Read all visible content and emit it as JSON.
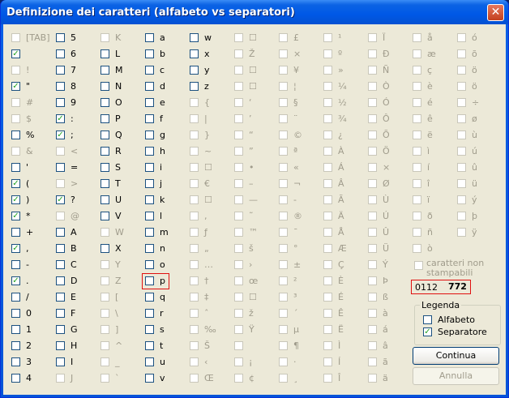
{
  "window": {
    "title": "Definizione dei caratteri (alfabeto vs separatori)",
    "close_glyph": "✕"
  },
  "grid_columns": [
    [
      {
        "l": "[TAB]",
        "c": false,
        "d": true
      },
      {
        "l": "",
        "c": true,
        "d": false
      },
      {
        "l": "!",
        "c": false,
        "d": true
      },
      {
        "l": "\"",
        "c": true,
        "d": false
      },
      {
        "l": "#",
        "c": false,
        "d": true
      },
      {
        "l": "$",
        "c": false,
        "d": true
      },
      {
        "l": "%",
        "c": false,
        "d": false
      },
      {
        "l": "&",
        "c": false,
        "d": true
      },
      {
        "l": "'",
        "c": false,
        "d": false
      },
      {
        "l": "(",
        "c": true,
        "d": false
      },
      {
        "l": ")",
        "c": true,
        "d": false
      },
      {
        "l": "*",
        "c": true,
        "d": false
      },
      {
        "l": "+",
        "c": false,
        "d": false
      },
      {
        "l": ",",
        "c": true,
        "d": false
      },
      {
        "l": "-",
        "c": false,
        "d": false
      },
      {
        "l": ".",
        "c": true,
        "d": false
      },
      {
        "l": "/",
        "c": false,
        "d": false
      },
      {
        "l": "0",
        "c": false,
        "d": false
      },
      {
        "l": "1",
        "c": false,
        "d": false
      },
      {
        "l": "2",
        "c": false,
        "d": false
      },
      {
        "l": "3",
        "c": false,
        "d": false
      },
      {
        "l": "4",
        "c": false,
        "d": false
      }
    ],
    [
      {
        "l": "5",
        "c": false,
        "d": false
      },
      {
        "l": "6",
        "c": false,
        "d": false
      },
      {
        "l": "7",
        "c": false,
        "d": false
      },
      {
        "l": "8",
        "c": false,
        "d": false
      },
      {
        "l": "9",
        "c": false,
        "d": false
      },
      {
        "l": ":",
        "c": true,
        "d": false
      },
      {
        "l": ";",
        "c": true,
        "d": false
      },
      {
        "l": "<",
        "c": false,
        "d": true
      },
      {
        "l": "=",
        "c": false,
        "d": false
      },
      {
        "l": ">",
        "c": false,
        "d": true
      },
      {
        "l": "?",
        "c": true,
        "d": false
      },
      {
        "l": "@",
        "c": false,
        "d": true
      },
      {
        "l": "A",
        "c": false,
        "d": false
      },
      {
        "l": "B",
        "c": false,
        "d": false
      },
      {
        "l": "C",
        "c": false,
        "d": false
      },
      {
        "l": "D",
        "c": false,
        "d": false
      },
      {
        "l": "E",
        "c": false,
        "d": false
      },
      {
        "l": "F",
        "c": false,
        "d": false
      },
      {
        "l": "G",
        "c": false,
        "d": false
      },
      {
        "l": "H",
        "c": false,
        "d": false
      },
      {
        "l": "I",
        "c": false,
        "d": false
      },
      {
        "l": "J",
        "c": false,
        "d": true
      }
    ],
    [
      {
        "l": "K",
        "c": false,
        "d": true
      },
      {
        "l": "L",
        "c": false,
        "d": false
      },
      {
        "l": "M",
        "c": false,
        "d": false
      },
      {
        "l": "N",
        "c": false,
        "d": false
      },
      {
        "l": "O",
        "c": false,
        "d": false
      },
      {
        "l": "P",
        "c": false,
        "d": false
      },
      {
        "l": "Q",
        "c": false,
        "d": false
      },
      {
        "l": "R",
        "c": false,
        "d": false
      },
      {
        "l": "S",
        "c": false,
        "d": false
      },
      {
        "l": "T",
        "c": false,
        "d": false
      },
      {
        "l": "U",
        "c": false,
        "d": false
      },
      {
        "l": "V",
        "c": false,
        "d": false
      },
      {
        "l": "W",
        "c": false,
        "d": true
      },
      {
        "l": "X",
        "c": false,
        "d": false
      },
      {
        "l": "Y",
        "c": false,
        "d": true
      },
      {
        "l": "Z",
        "c": false,
        "d": true
      },
      {
        "l": "[",
        "c": false,
        "d": true
      },
      {
        "l": "\\",
        "c": false,
        "d": true
      },
      {
        "l": "]",
        "c": false,
        "d": true
      },
      {
        "l": "^",
        "c": false,
        "d": true
      },
      {
        "l": "_",
        "c": false,
        "d": true
      },
      {
        "l": "`",
        "c": false,
        "d": true
      }
    ],
    [
      {
        "l": "a",
        "c": false,
        "d": false
      },
      {
        "l": "b",
        "c": false,
        "d": false
      },
      {
        "l": "c",
        "c": false,
        "d": false
      },
      {
        "l": "d",
        "c": false,
        "d": false
      },
      {
        "l": "e",
        "c": false,
        "d": false
      },
      {
        "l": "f",
        "c": false,
        "d": false
      },
      {
        "l": "g",
        "c": false,
        "d": false
      },
      {
        "l": "h",
        "c": false,
        "d": false
      },
      {
        "l": "i",
        "c": false,
        "d": false
      },
      {
        "l": "j",
        "c": false,
        "d": false
      },
      {
        "l": "k",
        "c": false,
        "d": false
      },
      {
        "l": "l",
        "c": false,
        "d": false
      },
      {
        "l": "m",
        "c": false,
        "d": false
      },
      {
        "l": "n",
        "c": false,
        "d": false
      },
      {
        "l": "o",
        "c": false,
        "d": false
      },
      {
        "l": "p",
        "c": false,
        "d": false,
        "hl": true
      },
      {
        "l": "q",
        "c": false,
        "d": false
      },
      {
        "l": "r",
        "c": false,
        "d": false
      },
      {
        "l": "s",
        "c": false,
        "d": false
      },
      {
        "l": "t",
        "c": false,
        "d": false
      },
      {
        "l": "u",
        "c": false,
        "d": false
      },
      {
        "l": "v",
        "c": false,
        "d": false
      }
    ],
    [
      {
        "l": "w",
        "c": false,
        "d": false
      },
      {
        "l": "x",
        "c": false,
        "d": false
      },
      {
        "l": "y",
        "c": false,
        "d": false
      },
      {
        "l": "z",
        "c": false,
        "d": false
      },
      {
        "l": "{",
        "c": false,
        "d": true
      },
      {
        "l": "|",
        "c": false,
        "d": true
      },
      {
        "l": "}",
        "c": false,
        "d": true
      },
      {
        "l": "~",
        "c": false,
        "d": true
      },
      {
        "l": "☐",
        "c": false,
        "d": true
      },
      {
        "l": "€",
        "c": false,
        "d": true
      },
      {
        "l": "☐",
        "c": false,
        "d": true
      },
      {
        "l": ",",
        "c": false,
        "d": true
      },
      {
        "l": "ƒ",
        "c": false,
        "d": true
      },
      {
        "l": "„",
        "c": false,
        "d": true
      },
      {
        "l": "…",
        "c": false,
        "d": true
      },
      {
        "l": "†",
        "c": false,
        "d": true
      },
      {
        "l": "‡",
        "c": false,
        "d": true
      },
      {
        "l": "ˆ",
        "c": false,
        "d": true
      },
      {
        "l": "‰",
        "c": false,
        "d": true
      },
      {
        "l": "Š",
        "c": false,
        "d": true
      },
      {
        "l": "‹",
        "c": false,
        "d": true
      },
      {
        "l": "Œ",
        "c": false,
        "d": true
      }
    ],
    [
      {
        "l": "☐",
        "c": false,
        "d": true
      },
      {
        "l": "Ž",
        "c": false,
        "d": true
      },
      {
        "l": "☐",
        "c": false,
        "d": true
      },
      {
        "l": "☐",
        "c": false,
        "d": true
      },
      {
        "l": "‘",
        "c": false,
        "d": true
      },
      {
        "l": "’",
        "c": false,
        "d": true
      },
      {
        "l": "“",
        "c": false,
        "d": true
      },
      {
        "l": "”",
        "c": false,
        "d": true
      },
      {
        "l": "•",
        "c": false,
        "d": true
      },
      {
        "l": "–",
        "c": false,
        "d": true
      },
      {
        "l": "—",
        "c": false,
        "d": true
      },
      {
        "l": "˜",
        "c": false,
        "d": true
      },
      {
        "l": "™",
        "c": false,
        "d": true
      },
      {
        "l": "š",
        "c": false,
        "d": true
      },
      {
        "l": "›",
        "c": false,
        "d": true
      },
      {
        "l": "œ",
        "c": false,
        "d": true
      },
      {
        "l": "☐",
        "c": false,
        "d": true
      },
      {
        "l": "ž",
        "c": false,
        "d": true
      },
      {
        "l": "Ÿ",
        "c": false,
        "d": true
      },
      {
        "l": "",
        "c": false,
        "d": true
      },
      {
        "l": "¡",
        "c": false,
        "d": true
      },
      {
        "l": "¢",
        "c": false,
        "d": true
      }
    ],
    [
      {
        "l": "£",
        "c": false,
        "d": true
      },
      {
        "l": "×",
        "c": false,
        "d": true
      },
      {
        "l": "¥",
        "c": false,
        "d": true
      },
      {
        "l": "¦",
        "c": false,
        "d": true
      },
      {
        "l": "§",
        "c": false,
        "d": true
      },
      {
        "l": "¨",
        "c": false,
        "d": true
      },
      {
        "l": "©",
        "c": false,
        "d": true
      },
      {
        "l": "ª",
        "c": false,
        "d": true
      },
      {
        "l": "«",
        "c": false,
        "d": true
      },
      {
        "l": "¬",
        "c": false,
        "d": true
      },
      {
        "l": "-",
        "c": false,
        "d": true
      },
      {
        "l": "®",
        "c": false,
        "d": true
      },
      {
        "l": "¯",
        "c": false,
        "d": true
      },
      {
        "l": "°",
        "c": false,
        "d": true
      },
      {
        "l": "±",
        "c": false,
        "d": true
      },
      {
        "l": "²",
        "c": false,
        "d": true
      },
      {
        "l": "³",
        "c": false,
        "d": true
      },
      {
        "l": "´",
        "c": false,
        "d": true
      },
      {
        "l": "µ",
        "c": false,
        "d": true
      },
      {
        "l": "¶",
        "c": false,
        "d": true
      },
      {
        "l": "·",
        "c": false,
        "d": true
      },
      {
        "l": "¸",
        "c": false,
        "d": true
      }
    ],
    [
      {
        "l": "¹",
        "c": false,
        "d": true
      },
      {
        "l": "º",
        "c": false,
        "d": true
      },
      {
        "l": "»",
        "c": false,
        "d": true
      },
      {
        "l": "¼",
        "c": false,
        "d": true
      },
      {
        "l": "½",
        "c": false,
        "d": true
      },
      {
        "l": "¾",
        "c": false,
        "d": true
      },
      {
        "l": "¿",
        "c": false,
        "d": true
      },
      {
        "l": "À",
        "c": false,
        "d": true
      },
      {
        "l": "Á",
        "c": false,
        "d": true
      },
      {
        "l": "Â",
        "c": false,
        "d": true
      },
      {
        "l": "Ã",
        "c": false,
        "d": true
      },
      {
        "l": "Ä",
        "c": false,
        "d": true
      },
      {
        "l": "Å",
        "c": false,
        "d": true
      },
      {
        "l": "Æ",
        "c": false,
        "d": true
      },
      {
        "l": "Ç",
        "c": false,
        "d": true
      },
      {
        "l": "È",
        "c": false,
        "d": true
      },
      {
        "l": "É",
        "c": false,
        "d": true
      },
      {
        "l": "Ê",
        "c": false,
        "d": true
      },
      {
        "l": "Ë",
        "c": false,
        "d": true
      },
      {
        "l": "Ì",
        "c": false,
        "d": true
      },
      {
        "l": "Í",
        "c": false,
        "d": true
      },
      {
        "l": "Î",
        "c": false,
        "d": true
      }
    ],
    [
      {
        "l": "Ï",
        "c": false,
        "d": true
      },
      {
        "l": "Ð",
        "c": false,
        "d": true
      },
      {
        "l": "Ñ",
        "c": false,
        "d": true
      },
      {
        "l": "Ò",
        "c": false,
        "d": true
      },
      {
        "l": "Ó",
        "c": false,
        "d": true
      },
      {
        "l": "Ô",
        "c": false,
        "d": true
      },
      {
        "l": "Õ",
        "c": false,
        "d": true
      },
      {
        "l": "Ö",
        "c": false,
        "d": true
      },
      {
        "l": "×",
        "c": false,
        "d": true
      },
      {
        "l": "Ø",
        "c": false,
        "d": true
      },
      {
        "l": "Ù",
        "c": false,
        "d": true
      },
      {
        "l": "Ú",
        "c": false,
        "d": true
      },
      {
        "l": "Û",
        "c": false,
        "d": true
      },
      {
        "l": "Ü",
        "c": false,
        "d": true
      },
      {
        "l": "Ý",
        "c": false,
        "d": true
      },
      {
        "l": "Þ",
        "c": false,
        "d": true
      },
      {
        "l": "ß",
        "c": false,
        "d": true
      },
      {
        "l": "à",
        "c": false,
        "d": true
      },
      {
        "l": "á",
        "c": false,
        "d": true
      },
      {
        "l": "â",
        "c": false,
        "d": true
      },
      {
        "l": "ã",
        "c": false,
        "d": true
      },
      {
        "l": "ä",
        "c": false,
        "d": true
      }
    ],
    [
      {
        "l": "å",
        "c": false,
        "d": true
      },
      {
        "l": "æ",
        "c": false,
        "d": true
      },
      {
        "l": "ç",
        "c": false,
        "d": true
      },
      {
        "l": "è",
        "c": false,
        "d": true
      },
      {
        "l": "é",
        "c": false,
        "d": true
      },
      {
        "l": "ê",
        "c": false,
        "d": true
      },
      {
        "l": "ë",
        "c": false,
        "d": true
      },
      {
        "l": "ì",
        "c": false,
        "d": true
      },
      {
        "l": "í",
        "c": false,
        "d": true
      },
      {
        "l": "î",
        "c": false,
        "d": true
      },
      {
        "l": "ï",
        "c": false,
        "d": true
      },
      {
        "l": "ð",
        "c": false,
        "d": true
      },
      {
        "l": "ñ",
        "c": false,
        "d": true
      },
      {
        "l": "ò",
        "c": false,
        "d": true
      }
    ],
    [
      {
        "l": "ó",
        "c": false,
        "d": true
      },
      {
        "l": "õ",
        "c": false,
        "d": true
      },
      {
        "l": "ö",
        "c": false,
        "d": true
      },
      {
        "l": "ö",
        "c": false,
        "d": true
      },
      {
        "l": "÷",
        "c": false,
        "d": true
      },
      {
        "l": "ø",
        "c": false,
        "d": true
      },
      {
        "l": "ù",
        "c": false,
        "d": true
      },
      {
        "l": "ú",
        "c": false,
        "d": true
      },
      {
        "l": "û",
        "c": false,
        "d": true
      },
      {
        "l": "ü",
        "c": false,
        "d": true
      },
      {
        "l": "ý",
        "c": false,
        "d": true
      },
      {
        "l": "þ",
        "c": false,
        "d": true
      },
      {
        "l": "ÿ",
        "c": false,
        "d": true
      }
    ]
  ],
  "nonprint": {
    "label": "caratteri non stampabili",
    "checked": false
  },
  "code_box": {
    "code": "0112",
    "value": "772"
  },
  "legend": {
    "title": "Legenda",
    "alfabeto": "Alfabeto",
    "separatore": "Separatore"
  },
  "buttons": {
    "continua": "Continua",
    "annulla": "Annulla"
  },
  "colors": {
    "highlight": "#e01010",
    "check": "#21a121",
    "disabled_text": "#a09c8c"
  }
}
